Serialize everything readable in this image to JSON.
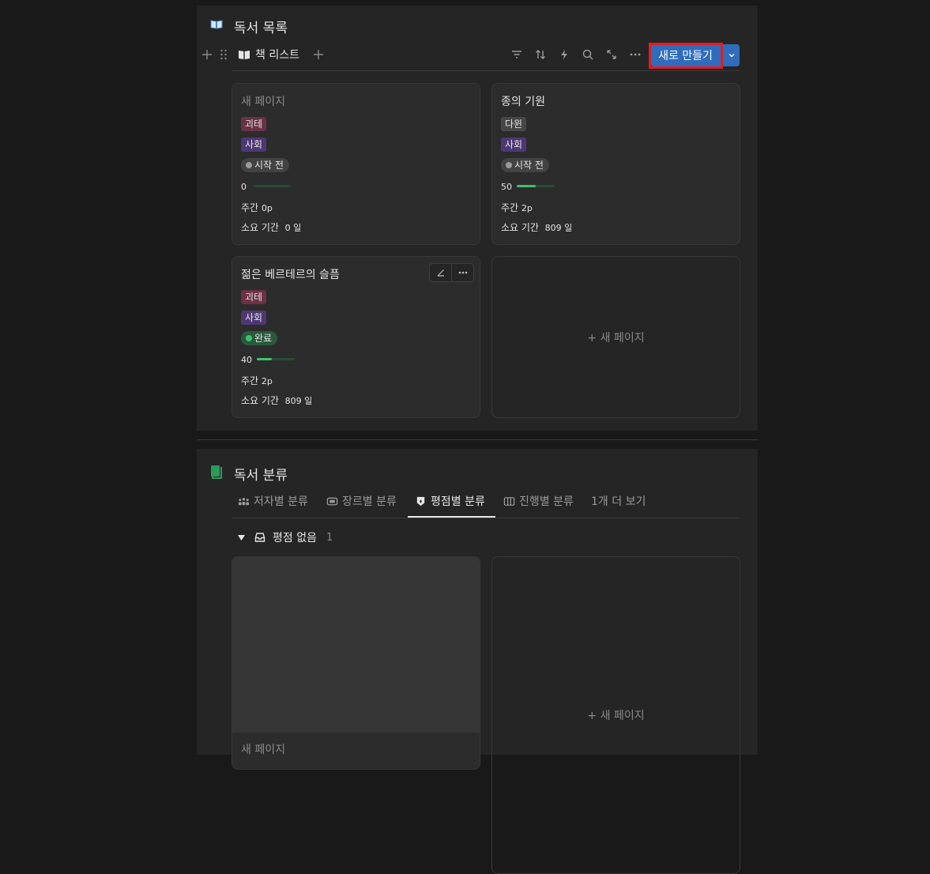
{
  "section1": {
    "title": "독서 목록",
    "icon": "open-book-icon",
    "view_name": "책 리스트",
    "new_button": "새로 만들기",
    "cards": [
      {
        "title": "새 페이지",
        "tags": [
          "괴테",
          "사회"
        ],
        "status": "시작 전",
        "progress_value": "0",
        "progress": 0,
        "weekly_label": "주간",
        "weekly_value": "0p",
        "duration_label": "소요 기간",
        "duration_value": "0 일"
      },
      {
        "title": "종의 기원",
        "tags": [
          "다윈",
          "사회"
        ],
        "status": "시작 전",
        "progress_value": "50",
        "progress": 0.5,
        "weekly_label": "주간",
        "weekly_value": "2p",
        "duration_label": "소요 기간",
        "duration_value": "809 일"
      },
      {
        "title": "젊은 베르테르의 슬픔",
        "tags": [
          "괴테",
          "사회"
        ],
        "status": "완료",
        "progress_value": "40",
        "progress": 0.4,
        "weekly_label": "주간",
        "weekly_value": "2p",
        "duration_label": "소요 기간",
        "duration_value": "809 일"
      }
    ],
    "add_page": "+ 새 페이지"
  },
  "section2": {
    "title": "독서 분류",
    "icon": "green-book-icon",
    "tabs": [
      {
        "label": "저자별 분류",
        "icon": "people-icon"
      },
      {
        "label": "장르별 분류",
        "icon": "tag-icon"
      },
      {
        "label": "평점별 분류",
        "icon": "shield-icon"
      },
      {
        "label": "진행별 분류",
        "icon": "columns-icon"
      }
    ],
    "more_tabs": "1개 더 보기",
    "group_label": "평점 없음",
    "group_count": "1",
    "card_title": "새 페이지",
    "add_page": "+ 새 페이지"
  },
  "colors": {
    "accent": "#2f6cbc",
    "highlight_outline": "#e11c23",
    "status_done": "#3ec26f"
  }
}
